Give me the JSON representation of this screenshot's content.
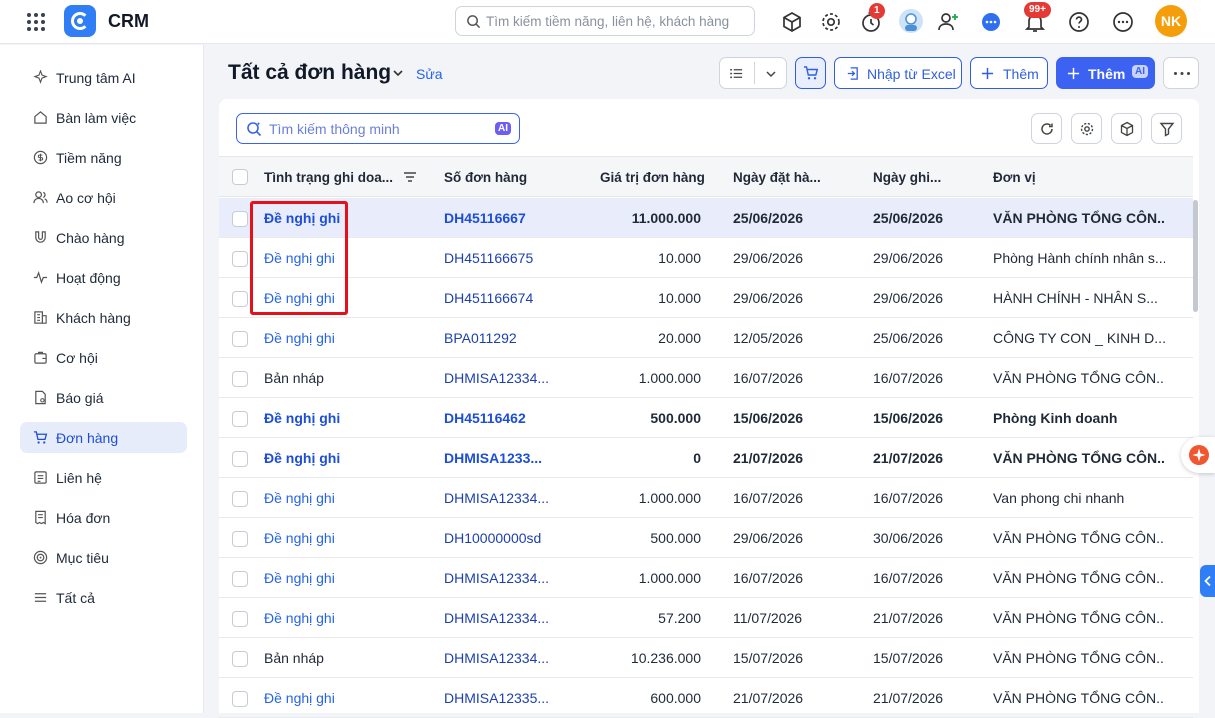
{
  "app": {
    "brand": "CRM",
    "search_placeholder": "Tìm kiếm tiềm năng, liên hệ, khách hàng",
    "timer_badge": "1",
    "notif_badge": "99+",
    "avatar_initials": "NK"
  },
  "sidebar": {
    "items": [
      {
        "label": "Trung tâm AI",
        "icon": "sparkle-icon"
      },
      {
        "label": "Bàn làm việc",
        "icon": "home-icon"
      },
      {
        "label": "Tiềm năng",
        "icon": "dollar-circle-icon"
      },
      {
        "label": "Ao cơ hội",
        "icon": "users-icon"
      },
      {
        "label": "Chào hàng",
        "icon": "magnet-icon"
      },
      {
        "label": "Hoạt động",
        "icon": "activity-icon"
      },
      {
        "label": "Khách hàng",
        "icon": "building-icon"
      },
      {
        "label": "Cơ hội",
        "icon": "briefcase-icon"
      },
      {
        "label": "Báo giá",
        "icon": "quote-doc-icon"
      },
      {
        "label": "Đơn hàng",
        "icon": "cart-icon"
      },
      {
        "label": "Liên hệ",
        "icon": "contact-card-icon"
      },
      {
        "label": "Hóa đơn",
        "icon": "invoice-icon"
      },
      {
        "label": "Mục tiêu",
        "icon": "target-icon"
      },
      {
        "label": "Tất cả",
        "icon": "menu-icon"
      }
    ],
    "active": "Đơn hàng"
  },
  "page": {
    "title": "Tất cả đơn hàng",
    "edit_label": "Sửa",
    "import_label": "Nhập từ Excel",
    "add_label": "Thêm",
    "add_ai_label": "Thêm",
    "ai_chip": "AI"
  },
  "table": {
    "search_placeholder": "Tìm kiếm thông minh",
    "ai_chip": "AI",
    "columns": [
      "Tình trạng ghi doa...",
      "Số đơn hàng",
      "Giá trị đơn hàng",
      "Ngày đặt hà...",
      "Ngày ghi...",
      "Đơn vị"
    ],
    "rows": [
      {
        "status": "Đề nghị ghi",
        "order": "DH45116667",
        "value": "11.000.000",
        "order_date": "25/06/2026",
        "record_date": "25/06/2026",
        "unit": "VĂN PHÒNG TỔNG CÔN...",
        "bold": true,
        "selected": true
      },
      {
        "status": "Đề nghị ghi",
        "order": "DH451166675",
        "value": "10.000",
        "order_date": "29/06/2026",
        "record_date": "29/06/2026",
        "unit": "Phòng Hành chính nhân s...",
        "bold": false
      },
      {
        "status": "Đề nghị ghi",
        "order": "DH451166674",
        "value": "10.000",
        "order_date": "29/06/2026",
        "record_date": "29/06/2026",
        "unit": "HÀNH CHÍNH - NHÂN S...",
        "bold": false
      },
      {
        "status": "Đề nghị ghi",
        "order": "BPA011292",
        "value": "20.000",
        "order_date": "12/05/2026",
        "record_date": "25/06/2026",
        "unit": "CÔNG TY CON _ KINH D...",
        "bold": false
      },
      {
        "status": "Bản nháp",
        "order": "DHMISA12334...",
        "value": "1.000.000",
        "order_date": "16/07/2026",
        "record_date": "16/07/2026",
        "unit": "VĂN PHÒNG TỔNG CÔN...",
        "bold": false
      },
      {
        "status": "Đề nghị ghi",
        "order": "DH45116462",
        "value": "500.000",
        "order_date": "15/06/2026",
        "record_date": "15/06/2026",
        "unit": "Phòng Kinh doanh",
        "bold": true
      },
      {
        "status": "Đề nghị ghi",
        "order": "DHMISA1233...",
        "value": "0",
        "order_date": "21/07/2026",
        "record_date": "21/07/2026",
        "unit": "VĂN PHÒNG TỔNG CÔN...",
        "bold": true
      },
      {
        "status": "Đề nghị ghi",
        "order": "DHMISA12334...",
        "value": "1.000.000",
        "order_date": "16/07/2026",
        "record_date": "16/07/2026",
        "unit": "Van phong chi nhanh",
        "bold": false
      },
      {
        "status": "Đề nghị ghi",
        "order": "DH10000000sd",
        "value": "500.000",
        "order_date": "29/06/2026",
        "record_date": "30/06/2026",
        "unit": "VĂN PHÒNG TỔNG CÔN...",
        "bold": false
      },
      {
        "status": "Đề nghị ghi",
        "order": "DHMISA12334...",
        "value": "1.000.000",
        "order_date": "16/07/2026",
        "record_date": "16/07/2026",
        "unit": "VĂN PHÒNG TỔNG CÔN...",
        "bold": false
      },
      {
        "status": "Đề nghị ghi",
        "order": "DHMISA12334...",
        "value": "57.200",
        "order_date": "11/07/2026",
        "record_date": "21/07/2026",
        "unit": "VĂN PHÒNG TỔNG CÔN...",
        "bold": false
      },
      {
        "status": "Bản nháp",
        "order": "DHMISA12334...",
        "value": "10.236.000",
        "order_date": "15/07/2026",
        "record_date": "15/07/2026",
        "unit": "VĂN PHÒNG TỔNG CÔN...",
        "bold": false
      },
      {
        "status": "Đề nghị ghi",
        "order": "DHMISA12335...",
        "value": "600.000",
        "order_date": "21/07/2026",
        "record_date": "21/07/2026",
        "unit": "VĂN PHÒNG TỔNG CÔN...",
        "bold": false
      }
    ]
  },
  "colors": {
    "accent": "#3b62f0",
    "highlight": "#e5101a",
    "badge": "#e53935",
    "avatar": "#f59e0b"
  }
}
